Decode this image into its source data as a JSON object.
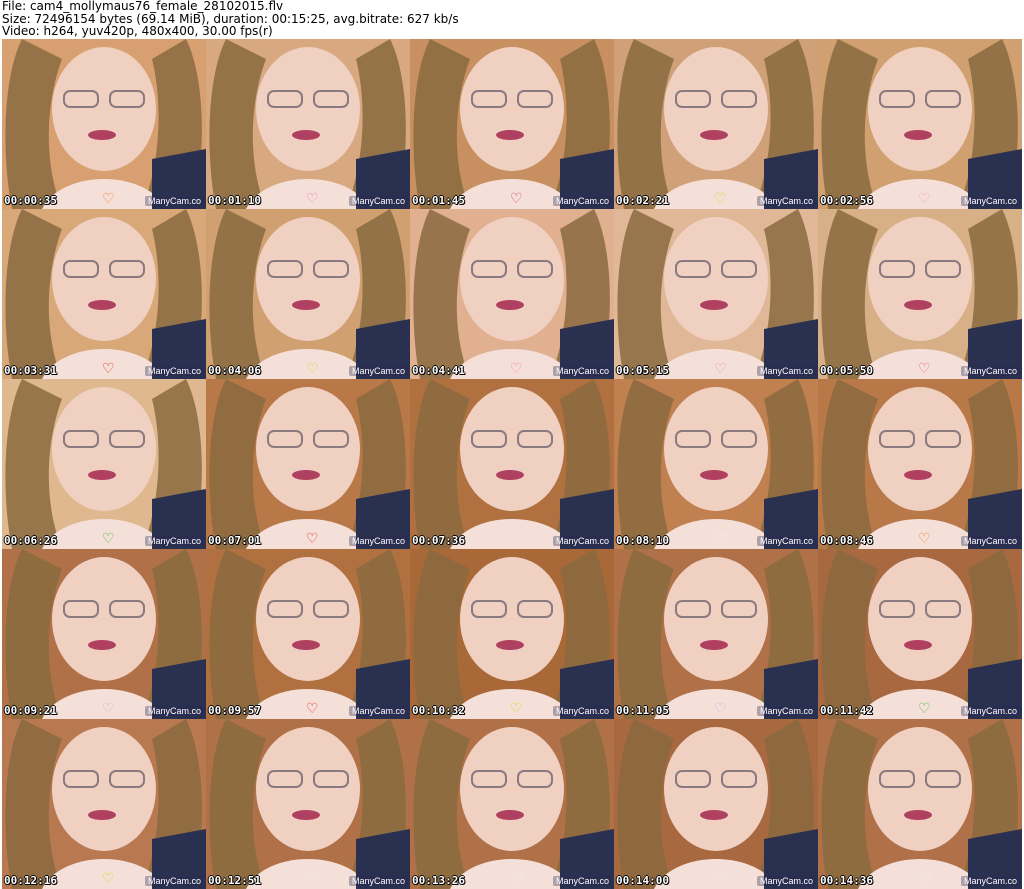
{
  "header": {
    "line1": "File: cam4_mollymaus76_female_28102015.flv",
    "line2": "Size: 72496154 bytes (69.14 MiB), duration: 00:15:25, avg.bitrate: 627 kb/s",
    "line3": "Video: h264, yuv420p, 480x400, 30.00 fps(r)"
  },
  "thumbnails": [
    {
      "time": "00:00:35",
      "watermark": "ManyCam.co",
      "bg": "#d8a070",
      "heart": "#f08030"
    },
    {
      "time": "00:01:10",
      "watermark": "ManyCam.co",
      "bg": "#d8a880",
      "heart": "#f080c0"
    },
    {
      "time": "00:01:45",
      "watermark": "ManyCam.co",
      "bg": "#c89060",
      "heart": "#d04080"
    },
    {
      "time": "00:02:21",
      "watermark": "ManyCam.co",
      "bg": "#d0a078",
      "heart": "#e0d020"
    },
    {
      "time": "00:02:56",
      "watermark": "ManyCam.co",
      "bg": "#d0a070",
      "heart": "#f0a0d0"
    },
    {
      "time": "00:03:31",
      "watermark": "ManyCam.co",
      "bg": "#d8a878",
      "heart": "#e03020"
    },
    {
      "time": "00:04:06",
      "watermark": "ManyCam.co",
      "bg": "#d0a070",
      "heart": "#e0d030"
    },
    {
      "time": "00:04:41",
      "watermark": "ManyCam.co",
      "bg": "#e0b090",
      "heart": "#f080c0"
    },
    {
      "time": "00:05:15",
      "watermark": "ManyCam.co",
      "bg": "#e0b898",
      "heart": "#f090d0"
    },
    {
      "time": "00:05:50",
      "watermark": "ManyCam.co",
      "bg": "#d8b088",
      "heart": "#e060b0"
    },
    {
      "time": "00:06:26",
      "watermark": "ManyCam.co",
      "bg": "#e0b890",
      "heart": "#40c040"
    },
    {
      "time": "00:07:01",
      "watermark": "ManyCam.co",
      "bg": "#b87848",
      "heart": "#e03020"
    },
    {
      "time": "00:07:36",
      "watermark": "ManyCam.co",
      "bg": "#b07040",
      "heart": "#f0d0e0"
    },
    {
      "time": "00:08:10",
      "watermark": "ManyCam.co",
      "bg": "#c08050",
      "heart": "#f0f0f0"
    },
    {
      "time": "00:08:46",
      "watermark": "ManyCam.co",
      "bg": "#b87848",
      "heart": "#f08030"
    },
    {
      "time": "00:09:21",
      "watermark": "ManyCam.co",
      "bg": "#b07048",
      "heart": "#f0a0e0"
    },
    {
      "time": "00:09:57",
      "watermark": "ManyCam.co",
      "bg": "#b07040",
      "heart": "#e03020"
    },
    {
      "time": "00:10:32",
      "watermark": "ManyCam.co",
      "bg": "#a86838",
      "heart": "#e0d020"
    },
    {
      "time": "00:11:05",
      "watermark": "ManyCam.co",
      "bg": "#b07048",
      "heart": "#f0a0e0"
    },
    {
      "time": "00:11:42",
      "watermark": "ManyCam.co",
      "bg": "#a86840",
      "heart": "#40c040"
    },
    {
      "time": "00:12:16",
      "watermark": "ManyCam.co",
      "bg": "#b87850",
      "heart": "#e0d020"
    },
    {
      "time": "00:12:51",
      "watermark": "ManyCam.co",
      "bg": "#b07048",
      "heart": "#f0f0f0"
    },
    {
      "time": "00:13:26",
      "watermark": "ManyCam.co",
      "bg": "#b07048",
      "heart": "#f0f0f0"
    },
    {
      "time": "00:14:00",
      "watermark": "ManyCam.co",
      "bg": "#a86840",
      "heart": "#f0f0f0"
    },
    {
      "time": "00:14:36",
      "watermark": "ManyCam.co",
      "bg": "#b07048",
      "heart": "#f0f0f0"
    }
  ]
}
